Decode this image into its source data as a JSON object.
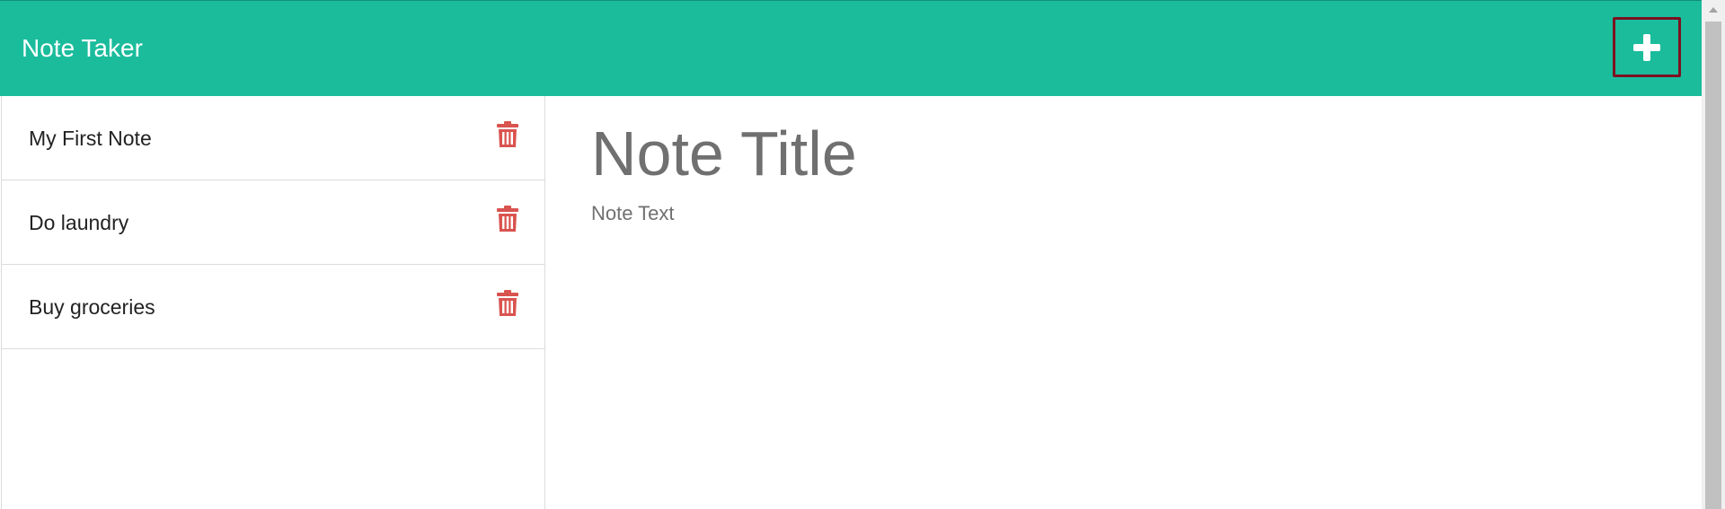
{
  "app": {
    "brand": "Note Taker"
  },
  "header": {
    "new_note_icon": "plus-icon"
  },
  "sidebar": {
    "notes": [
      {
        "title": "My First Note",
        "delete_icon": "trash-icon"
      },
      {
        "title": "Do laundry",
        "delete_icon": "trash-icon"
      },
      {
        "title": "Buy groceries",
        "delete_icon": "trash-icon"
      }
    ]
  },
  "editor": {
    "title_placeholder": "Note Title",
    "title_value": "",
    "text_placeholder": "Note Text",
    "text_value": ""
  },
  "colors": {
    "navbar": "#1abc9c",
    "delete_icon": "#d9534f",
    "highlight_border": "#7d1020",
    "placeholder_text": "#707070"
  }
}
